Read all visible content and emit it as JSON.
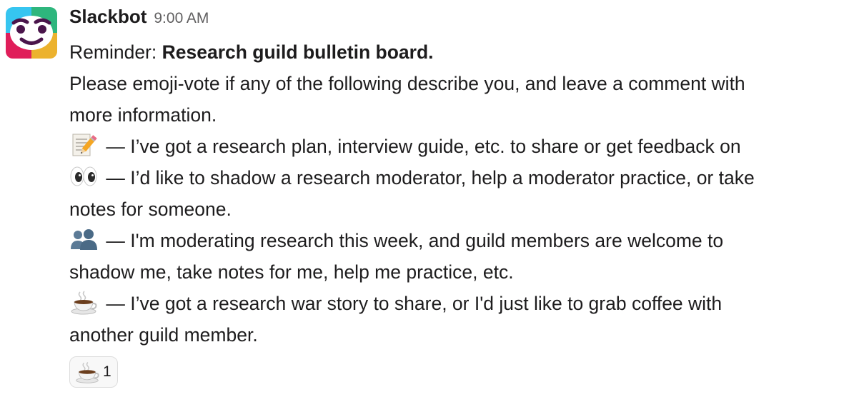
{
  "message": {
    "sender": "Slackbot",
    "timestamp": "9:00 AM",
    "reminder_prefix": "Reminder: ",
    "reminder_title": "Research guild bulletin board.",
    "intro_line1": "Please emoji-vote if any of the following describe you, and leave a comment with",
    "intro_line2": "more information.",
    "options": [
      {
        "emoji": "memo-icon",
        "line1": " — I’ve got a research plan, interview guide, etc. to share or get feedback on",
        "line2": ""
      },
      {
        "emoji": "eyes-icon",
        "line1": " — I’d like to shadow a research moderator, help a moderator practice, or take",
        "line2": "notes for someone."
      },
      {
        "emoji": "busts-in-silhouette-icon",
        "line1": " — I'm moderating research this week, and guild members are welcome to",
        "line2": "shadow me, take notes for me, help me practice, etc."
      },
      {
        "emoji": "coffee-icon",
        "line1": " — I’ve got a research war story to share, or I'd just like to grab coffee with",
        "line2": "another guild member."
      }
    ],
    "reactions": [
      {
        "emoji": "coffee-icon",
        "count": "1"
      }
    ]
  },
  "colors": {
    "text": "#1d1c1d",
    "timestamp": "#616061",
    "reaction_border": "#dddddd",
    "slack_blue": "#36c5f0",
    "slack_green": "#2eb67d",
    "slack_yellow": "#ecb22e",
    "slack_red": "#e01e5a"
  }
}
